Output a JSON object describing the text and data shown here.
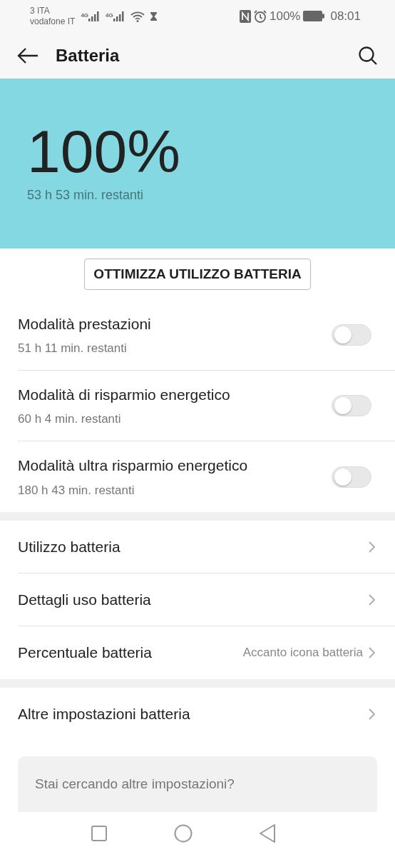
{
  "status_bar": {
    "carriers": [
      "3 ITA",
      "vodafone IT"
    ],
    "network_labels": [
      "4G",
      "4G"
    ],
    "battery_percent": "100%",
    "time": "08:01"
  },
  "app_bar": {
    "title": "Batteria"
  },
  "hero": {
    "percent": "100%",
    "remaining": "53 h 53 min. restanti"
  },
  "optimize_button": "OTTIMIZZA UTILIZZO BATTERIA",
  "modes": [
    {
      "title": "Modalità prestazioni",
      "subtitle": "51 h 11 min. restanti",
      "on": false
    },
    {
      "title": "Modalità di risparmio energetico",
      "subtitle": "60 h 4 min. restanti",
      "on": false
    },
    {
      "title": "Modalità ultra risparmio energetico",
      "subtitle": "180 h 43 min. restanti",
      "on": false
    }
  ],
  "settings_groups": [
    [
      {
        "label": "Utilizzo batteria"
      },
      {
        "label": "Dettagli uso batteria"
      },
      {
        "label": "Percentuale batteria",
        "value": "Accanto icona batteria"
      }
    ],
    [
      {
        "label": "Altre impostazioni batteria"
      }
    ]
  ],
  "suggestion_card": {
    "text": "Stai cercando altre impostazioni?"
  }
}
